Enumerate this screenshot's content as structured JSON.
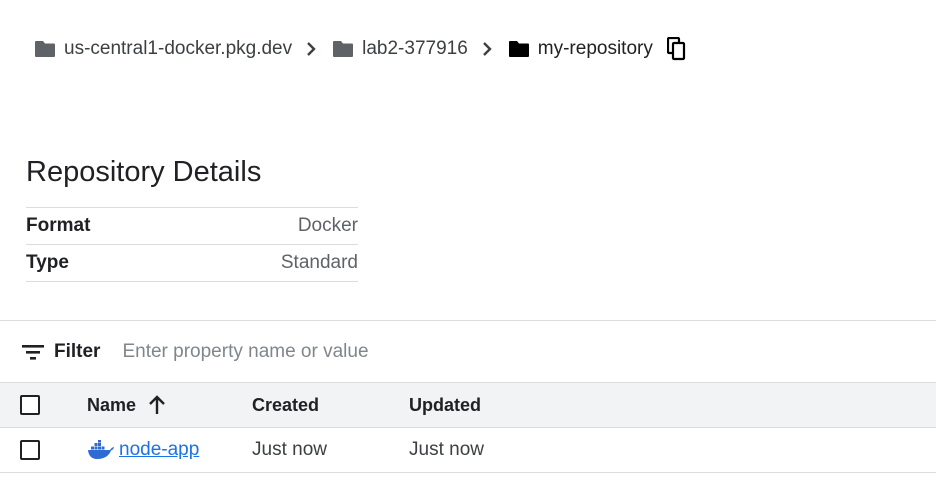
{
  "breadcrumb": {
    "items": [
      {
        "label": "us-central1-docker.pkg.dev",
        "icon": "folder-icon"
      },
      {
        "label": "lab2-377916",
        "icon": "folder-icon"
      },
      {
        "label": "my-repository",
        "icon": "folder-icon"
      }
    ],
    "separator_icon": "chevron-right-icon",
    "copy_icon": "copy-icon"
  },
  "details": {
    "title": "Repository Details",
    "rows": [
      {
        "key": "Format",
        "value": "Docker"
      },
      {
        "key": "Type",
        "value": "Standard"
      }
    ]
  },
  "filter": {
    "label": "Filter",
    "placeholder": "Enter property name or value",
    "value": ""
  },
  "table": {
    "columns": [
      "Name",
      "Created",
      "Updated"
    ],
    "sort_icon": "arrow-up-icon",
    "rows": [
      {
        "name": "node-app",
        "created": "Just now",
        "updated": "Just now",
        "icon": "docker-icon"
      }
    ]
  },
  "colors": {
    "link": "#1a73e8",
    "header_bg": "#f1f3f4",
    "divider": "#dadce0"
  }
}
